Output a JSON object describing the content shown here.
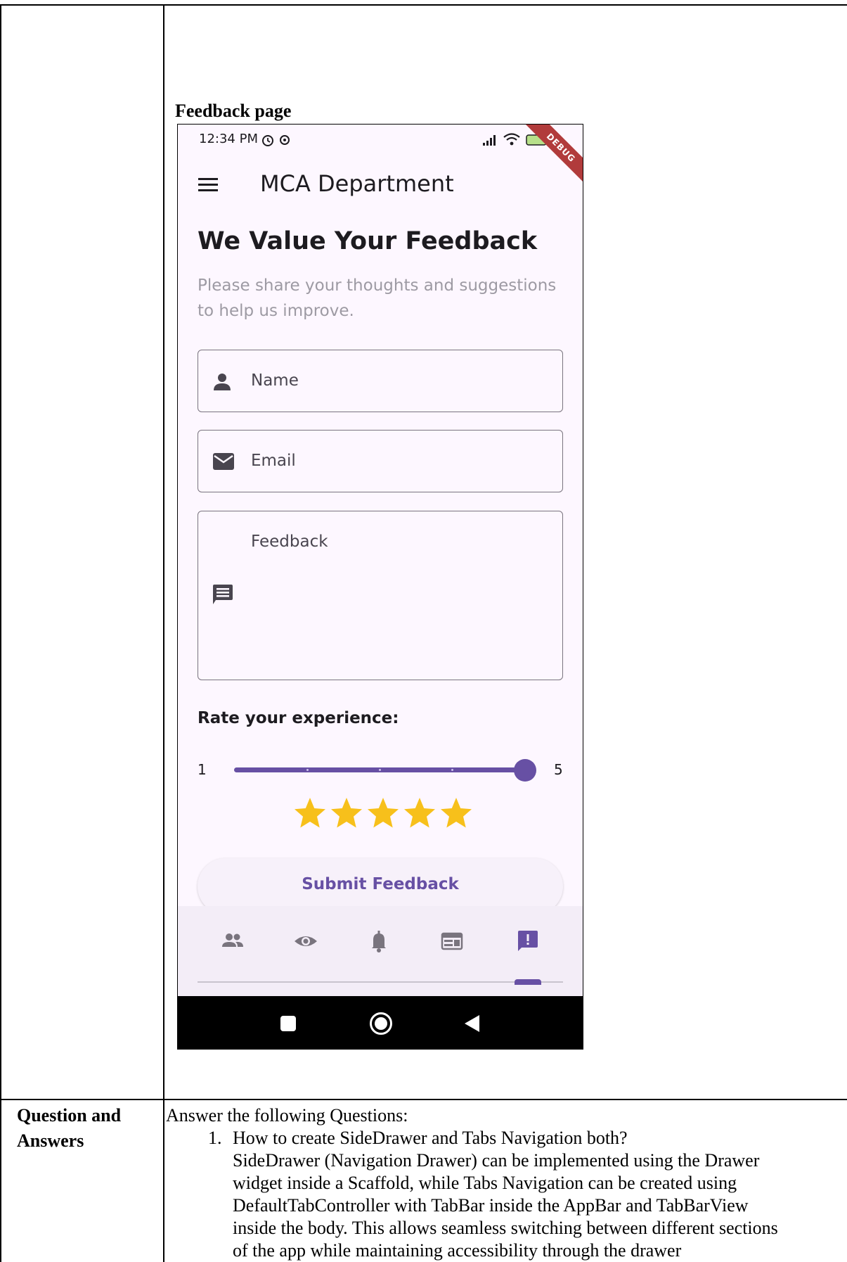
{
  "document": {
    "section_caption": "Feedback page",
    "question_cell_label_line1": "Question and",
    "question_cell_label_line2": "Answers",
    "answers_intro": "Answer the following Questions:",
    "question_number": "1.",
    "question_text": "How to create SideDrawer and Tabs Navigation both?",
    "answer_lines": [
      "SideDrawer (Navigation Drawer) can be implemented using the Drawer",
      "widget inside a Scaffold, while Tabs Navigation can be created using",
      "DefaultTabController with TabBar inside the AppBar and TabBarView",
      "inside the body. This allows seamless switching between different sections",
      "of the app while maintaining accessibility through the drawer"
    ]
  },
  "phone": {
    "status_time": "12:34 PM",
    "debug_banner": "DEBUG",
    "app_title": "MCA Department",
    "heading": "We Value Your Feedback",
    "subheading": "Please share your thoughts and suggestions to help us improve.",
    "fields": {
      "name_label": "Name",
      "email_label": "Email",
      "feedback_label": "Feedback"
    },
    "rating": {
      "label": "Rate your experience:",
      "min_label": "1",
      "max_label": "5",
      "value": 5,
      "min": 1,
      "max": 5,
      "stars_filled": 5,
      "star_color": "#f7c01b"
    },
    "submit_label": "Submit Feedback",
    "bottom_nav": {
      "items": [
        "people-icon",
        "visibility-icon",
        "notifications-icon",
        "web-layout-icon",
        "feedback-icon"
      ],
      "selected_index": 4
    },
    "colors": {
      "primary": "#6750a4",
      "surface": "#fdf7ff",
      "nav_background": "#f3edf7"
    }
  }
}
